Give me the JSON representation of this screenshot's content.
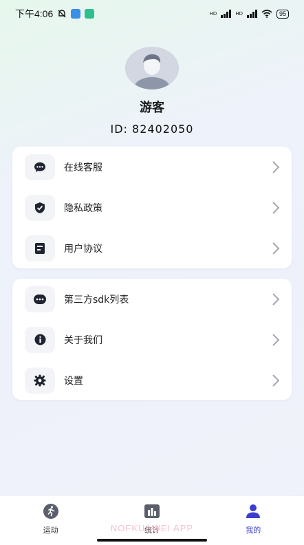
{
  "status_bar": {
    "time": "下午4:06",
    "signal1_label": "HD",
    "signal2_label": "HD",
    "battery": "95"
  },
  "profile": {
    "username": "游客",
    "id_label": "ID:",
    "id_value": "82402050"
  },
  "menu_group1": [
    {
      "label": "在线客服",
      "icon": "chat-bubble-icon"
    },
    {
      "label": "隐私政策",
      "icon": "shield-check-icon"
    },
    {
      "label": "用户协议",
      "icon": "document-icon"
    }
  ],
  "menu_group2": [
    {
      "label": "第三方sdk列表",
      "icon": "ellipsis-icon"
    },
    {
      "label": "关于我们",
      "icon": "info-icon"
    },
    {
      "label": "设置",
      "icon": "gear-icon"
    }
  ],
  "tabbar": {
    "tabs": [
      {
        "label": "运动",
        "icon": "running-icon",
        "active": false
      },
      {
        "label": "统计",
        "icon": "bar-chart-icon",
        "active": false
      },
      {
        "label": "我的",
        "icon": "person-icon",
        "active": true
      }
    ]
  },
  "watermark": "NOFKUAWEI APP",
  "colors": {
    "accent": "#3b3fcf",
    "icon_dark": "#1f2430",
    "card_bg": "#ffffff",
    "icon_box_bg": "#f2f4f8"
  }
}
